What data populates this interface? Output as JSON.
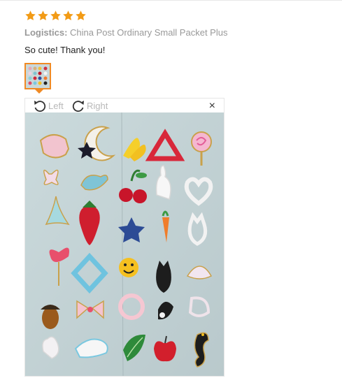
{
  "review": {
    "rating": 5,
    "star_color": "#f29b16",
    "logistics_label": "Logistics:",
    "logistics_value": "China Post Ordinary Small Packet Plus",
    "comment": "So cute! Thank you!"
  },
  "viewer": {
    "rotate_left_label": "Left",
    "rotate_right_label": "Right",
    "close_glyph": "×",
    "accent_color": "#f08a24"
  },
  "icons": [
    "star-icon",
    "rotate-left-icon",
    "rotate-right-icon",
    "close-icon"
  ]
}
